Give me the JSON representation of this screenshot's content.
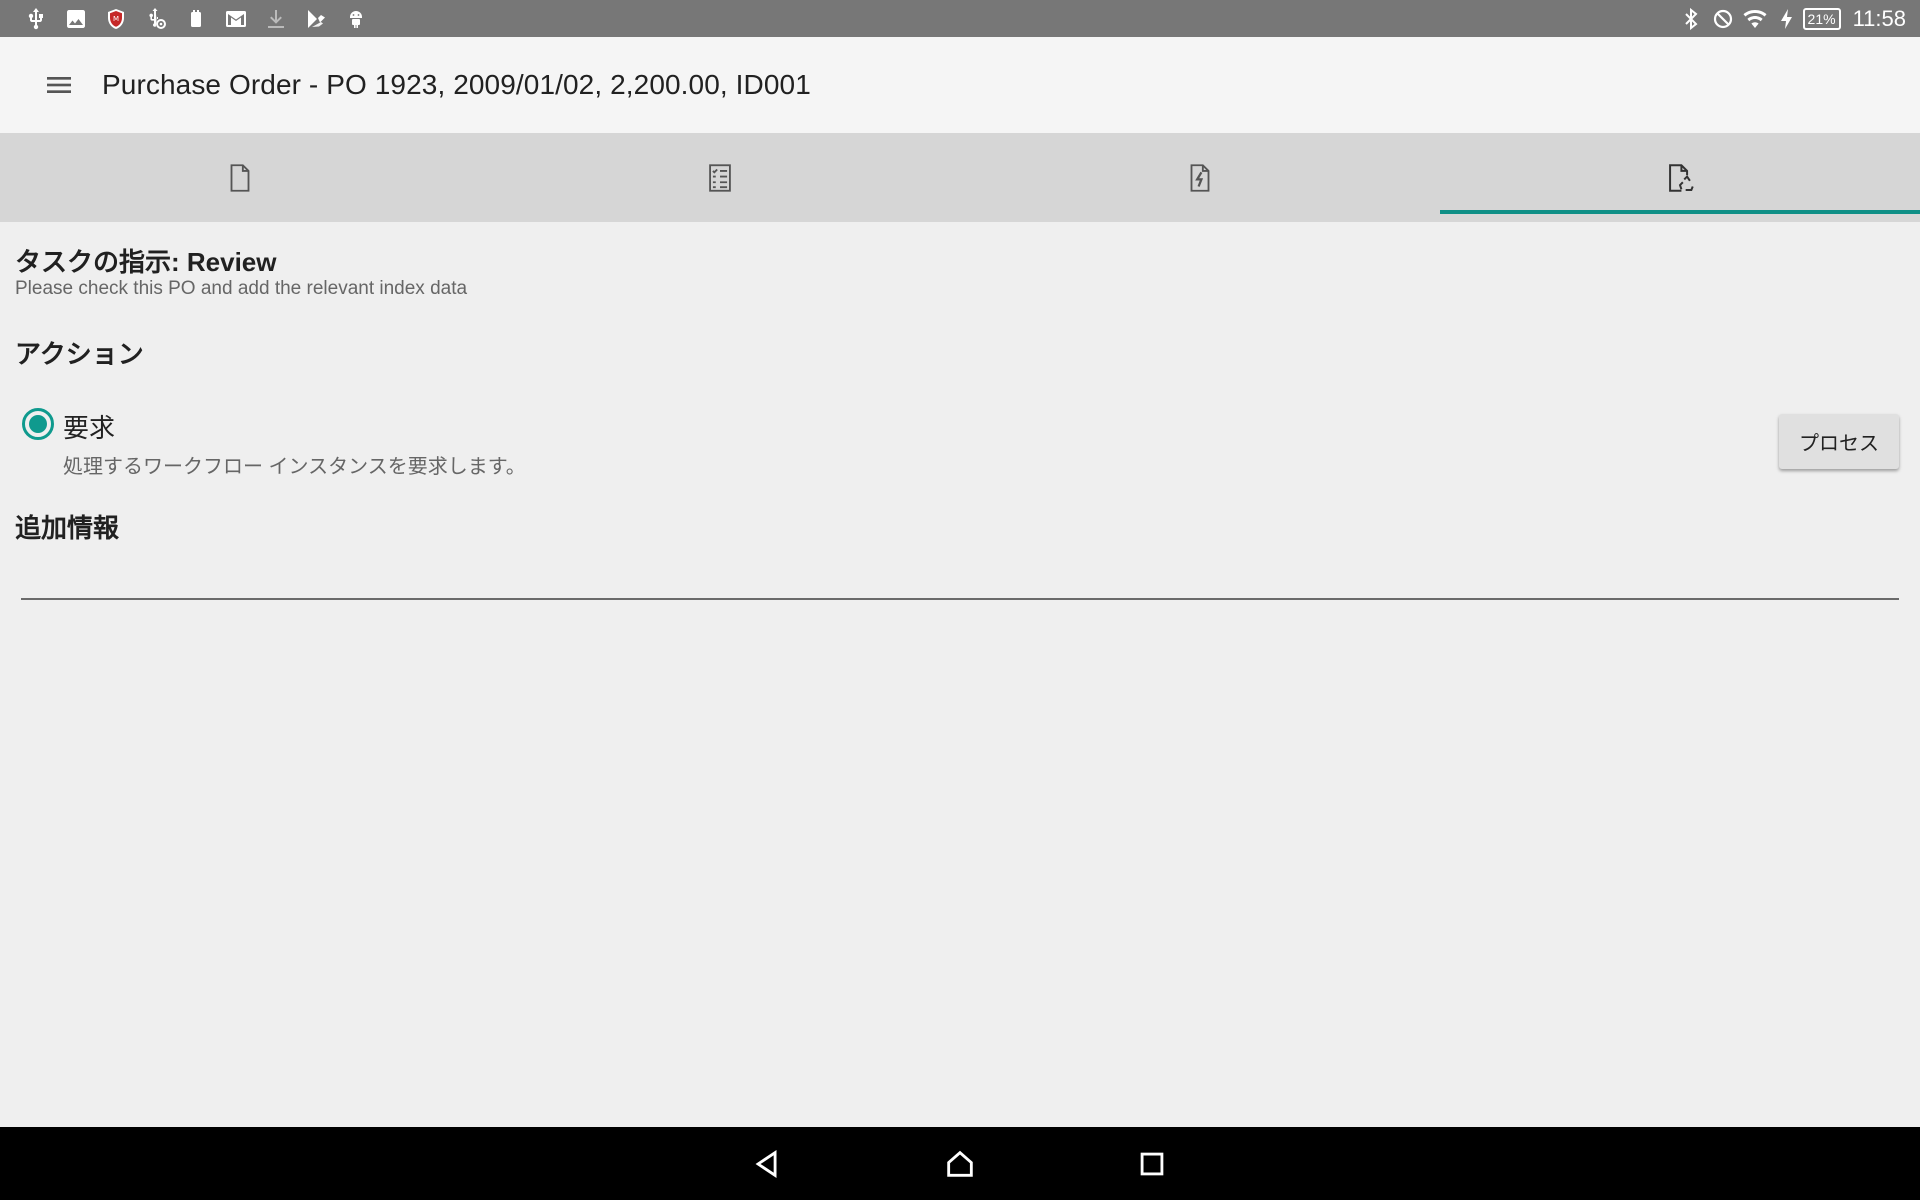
{
  "status_bar": {
    "left_icons": [
      "usb-icon",
      "image-icon",
      "mcafee-shield-icon",
      "usb-settings-icon",
      "screenshot-icon",
      "gmail-icon",
      "download-icon",
      "play-store-icon",
      "android-icon"
    ],
    "right_icons": [
      "bluetooth-icon",
      "do-not-disturb-icon",
      "wifi-icon",
      "charging-icon"
    ],
    "battery": "21%",
    "time": "11:58"
  },
  "app_bar": {
    "title": "Purchase Order - PO 1923, 2009/01/02, 2,200.00, ID001"
  },
  "tabs": [
    {
      "icon": "document-icon",
      "active": false
    },
    {
      "icon": "checklist-icon",
      "active": false
    },
    {
      "icon": "document-workflow-icon",
      "active": false
    },
    {
      "icon": "document-recycle-icon",
      "active": true
    }
  ],
  "task": {
    "heading": "タスクの指示: Review",
    "description": "Please check this PO and add the relevant index data"
  },
  "actions": {
    "heading": "アクション",
    "option": {
      "label": "要求",
      "description": "処理するワークフロー インスタンスを要求します。",
      "selected": true
    },
    "process_button": "プロセス"
  },
  "additional_info": {
    "heading": "追加情報",
    "value": ""
  },
  "colors": {
    "accent": "#0f9a8e",
    "status_bar": "#777777",
    "tab_bar": "#d6d6d6",
    "nav_bar": "#000000"
  }
}
